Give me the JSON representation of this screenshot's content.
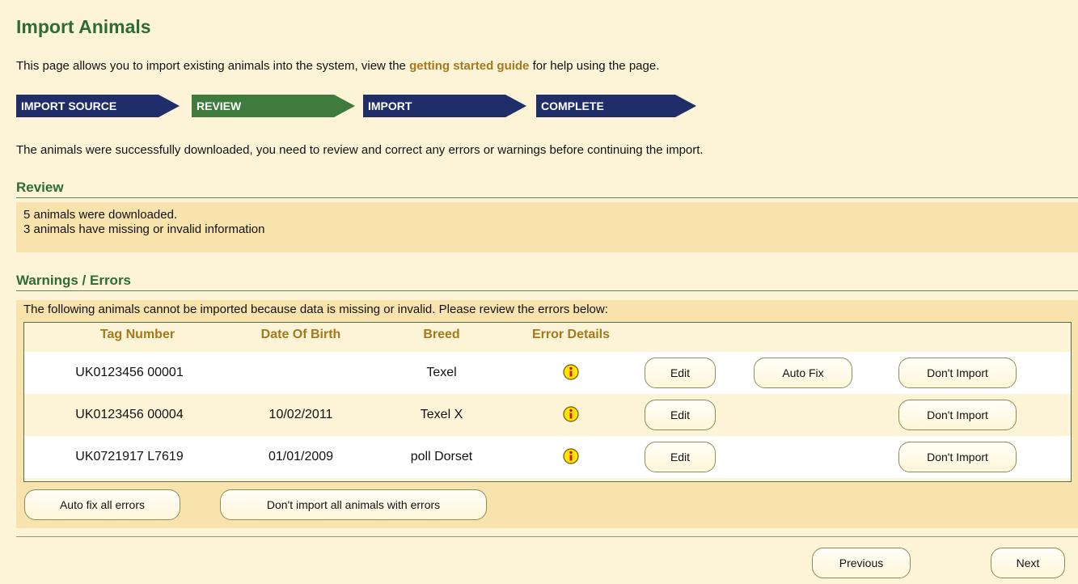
{
  "page": {
    "title": "Import Animals",
    "intro_before": "This page allows you to import existing animals into the system, view the ",
    "intro_link": "getting started guide",
    "intro_after": " for help using the page."
  },
  "steps": [
    {
      "label": "IMPORT SOURCE",
      "active": false
    },
    {
      "label": "REVIEW",
      "active": true
    },
    {
      "label": "IMPORT",
      "active": false
    },
    {
      "label": "COMPLETE",
      "active": false
    }
  ],
  "status_message": "The animals were successfully downloaded, you need to review and correct any errors or warnings before continuing the import.",
  "review": {
    "heading": "Review",
    "lines": [
      "5 animals were downloaded.",
      "3 animals have missing or invalid information"
    ]
  },
  "warnings": {
    "heading": "Warnings / Errors",
    "intro": "The following animals cannot be imported because data is missing or invalid. Please review the errors below:",
    "columns": [
      "Tag Number",
      "Date Of Birth",
      "Breed",
      "Error Details"
    ],
    "rows": [
      {
        "tag": "UK0123456 00001",
        "dob": "",
        "breed": "Texel",
        "edit": "Edit",
        "auto_fix": "Auto Fix",
        "dont_import": "Don't Import"
      },
      {
        "tag": "UK0123456 00004",
        "dob": "10/02/2011",
        "breed": "Texel X",
        "edit": "Edit",
        "auto_fix": "",
        "dont_import": "Don't Import"
      },
      {
        "tag": "UK0721917 L7619",
        "dob": "01/01/2009",
        "breed": "poll Dorset",
        "edit": "Edit",
        "auto_fix": "",
        "dont_import": "Don't Import"
      }
    ],
    "auto_fix_all": "Auto fix all errors",
    "dont_import_all": "Don't import all animals with errors"
  },
  "nav": {
    "previous": "Previous",
    "next": "Next"
  },
  "colors": {
    "accent_green": "#2e6b3a",
    "step_blue": "#1f2d68",
    "step_active": "#3e7b3c",
    "link_gold": "#a6781c",
    "band": "#f9e3ac",
    "background": "#fdf3d6"
  },
  "icons": {
    "error_details": "info-icon"
  }
}
